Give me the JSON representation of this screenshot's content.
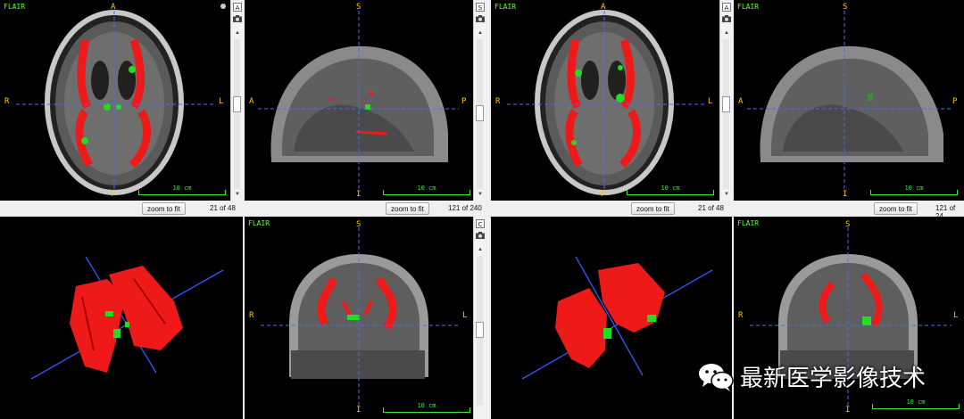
{
  "colors": {
    "lesion_red": "#ff1a1a",
    "lesion_green": "#22dd22",
    "crosshair_blue": "#4a6bff",
    "orientation_orange": "#ffc61a",
    "ruler_green": "#3ee63e"
  },
  "seq_label": "FLAIR",
  "ruler_label": "10 cm",
  "orient": {
    "A": "A",
    "P": "P",
    "R": "R",
    "L": "L",
    "S": "S",
    "I": "I"
  },
  "sidebar": {
    "btn_axial": "A",
    "btn_sagittal": "S",
    "btn_coronal": "C"
  },
  "status": {
    "zoom_label": "zoom to fit",
    "axial_count": "21 of 48",
    "sagittal_count": "121 of 240",
    "sagittal_count_right": "121 of 24"
  },
  "watermark": {
    "text": "最新医学影像技术",
    "icon": "wechat-icon"
  }
}
